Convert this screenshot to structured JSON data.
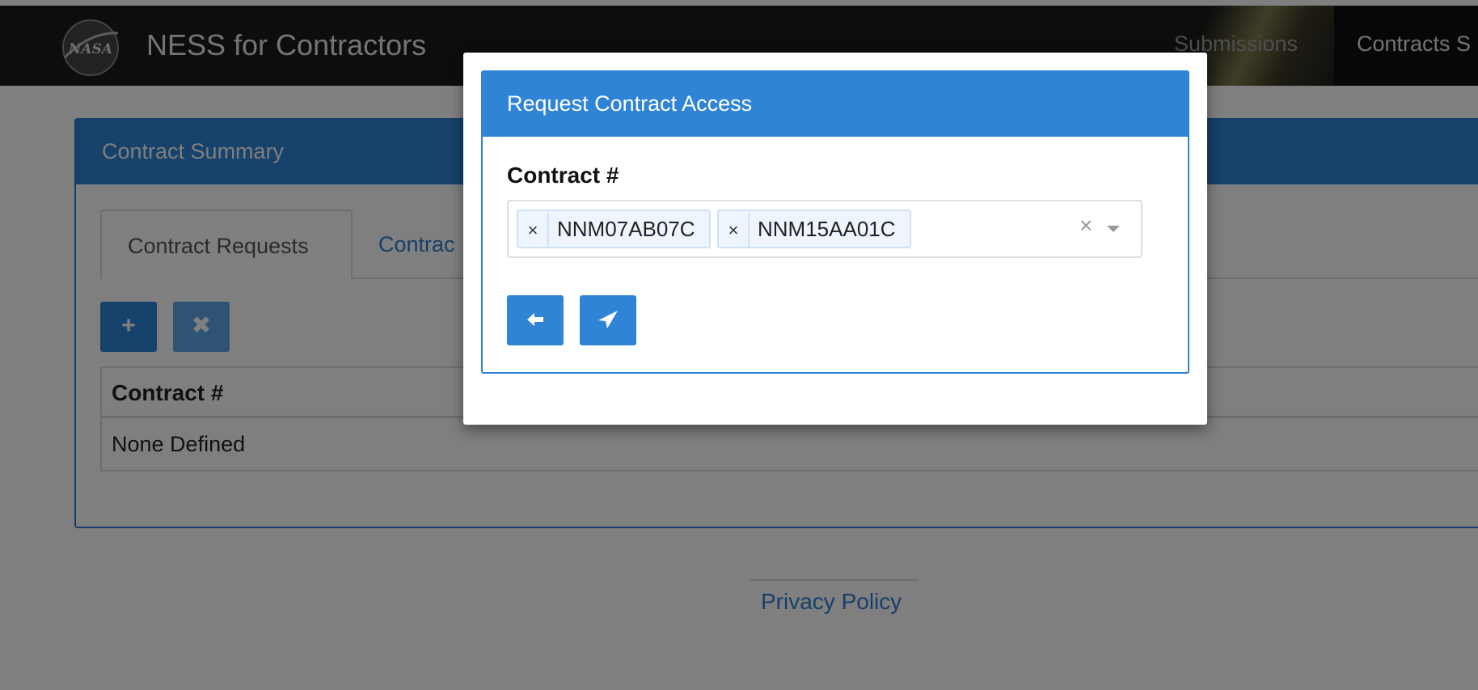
{
  "navbar": {
    "brand": "NESS for Contractors",
    "links": [
      "Submissions",
      "Contracts S"
    ]
  },
  "panel": {
    "heading": "Contract Summary",
    "tabs": [
      "Contract Requests",
      "Contrac"
    ],
    "table": {
      "header": "Contract #",
      "rows": [
        "None Defined"
      ]
    }
  },
  "footer": {
    "privacy": "Privacy Policy"
  },
  "modal": {
    "title": "Request Contract Access",
    "field_label": "Contract #",
    "selected": [
      "NNM07AB07C",
      "NNM15AA01C"
    ],
    "tag_remove": "×",
    "clear": "×"
  },
  "icons": {
    "add": "plus-icon",
    "delete": "close-icon",
    "back": "arrow-left-icon",
    "send": "paper-plane-icon"
  }
}
